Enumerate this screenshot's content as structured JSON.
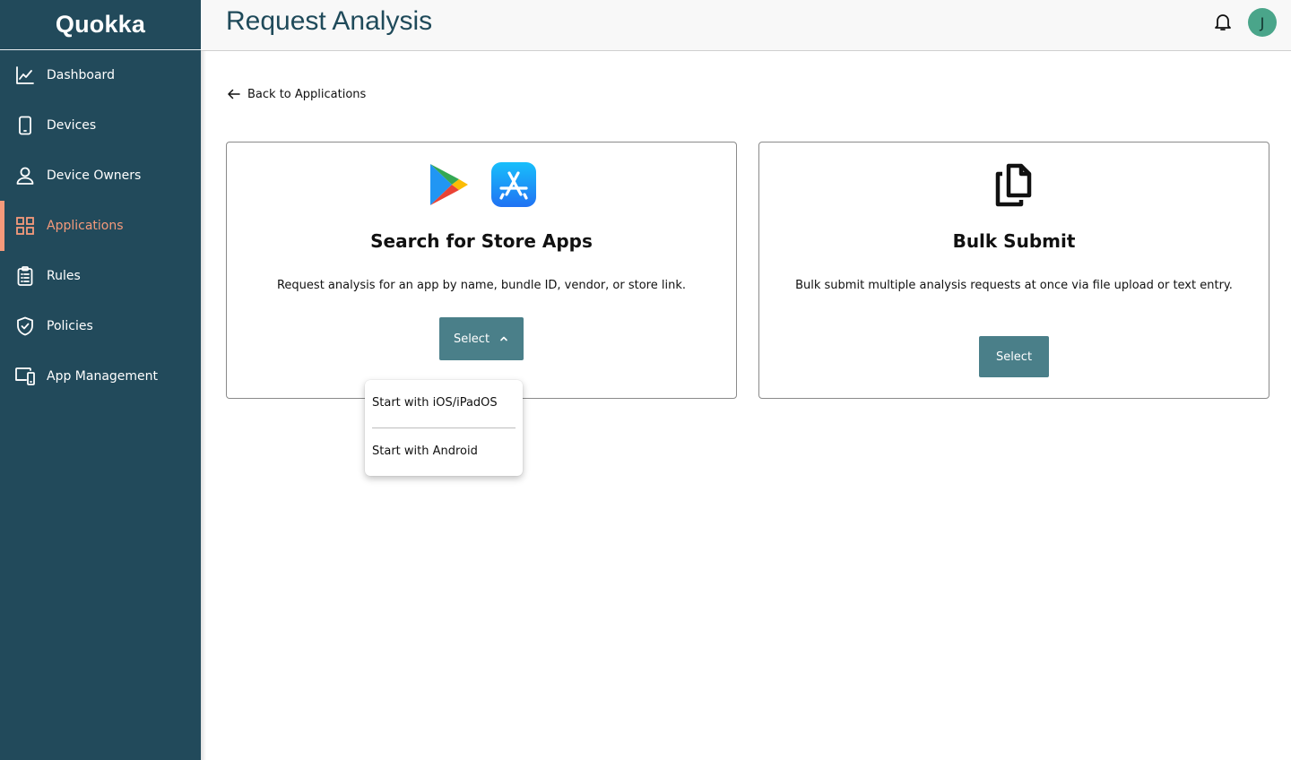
{
  "brand": {
    "name": "Quokka"
  },
  "sidebar": {
    "items": [
      {
        "label": "Dashboard",
        "icon": "chart-line-icon",
        "active": false
      },
      {
        "label": "Devices",
        "icon": "phone-icon",
        "active": false
      },
      {
        "label": "Device Owners",
        "icon": "user-icon",
        "active": false
      },
      {
        "label": "Applications",
        "icon": "grid-icon",
        "active": true
      },
      {
        "label": "Rules",
        "icon": "clipboard-list-icon",
        "active": false
      },
      {
        "label": "Policies",
        "icon": "shield-check-icon",
        "active": false
      },
      {
        "label": "App Management",
        "icon": "devices-icon",
        "active": false
      }
    ],
    "active_color": "#f59a7b",
    "background": "#224a5b"
  },
  "header": {
    "title": "Request Analysis",
    "avatar_initial": "J",
    "avatar_color": "#4aa58a"
  },
  "back_link": {
    "label": "Back to Applications"
  },
  "cards": {
    "store": {
      "title": "Search for Store Apps",
      "description": "Request analysis for an app by name, bundle ID, vendor, or store link.",
      "button_label": "Select",
      "icons": [
        "google-play-icon",
        "app-store-icon"
      ]
    },
    "bulk": {
      "title": "Bulk Submit",
      "description": "Bulk submit multiple analysis requests at once via file upload or text entry.",
      "button_label": "Select",
      "icons": [
        "copy-document-icon"
      ]
    }
  },
  "dropdown": {
    "open": true,
    "options": [
      "Start with iOS/iPadOS",
      "Start with Android"
    ]
  },
  "colors": {
    "button": "#4a7f89",
    "title": "#1f4a5a"
  }
}
